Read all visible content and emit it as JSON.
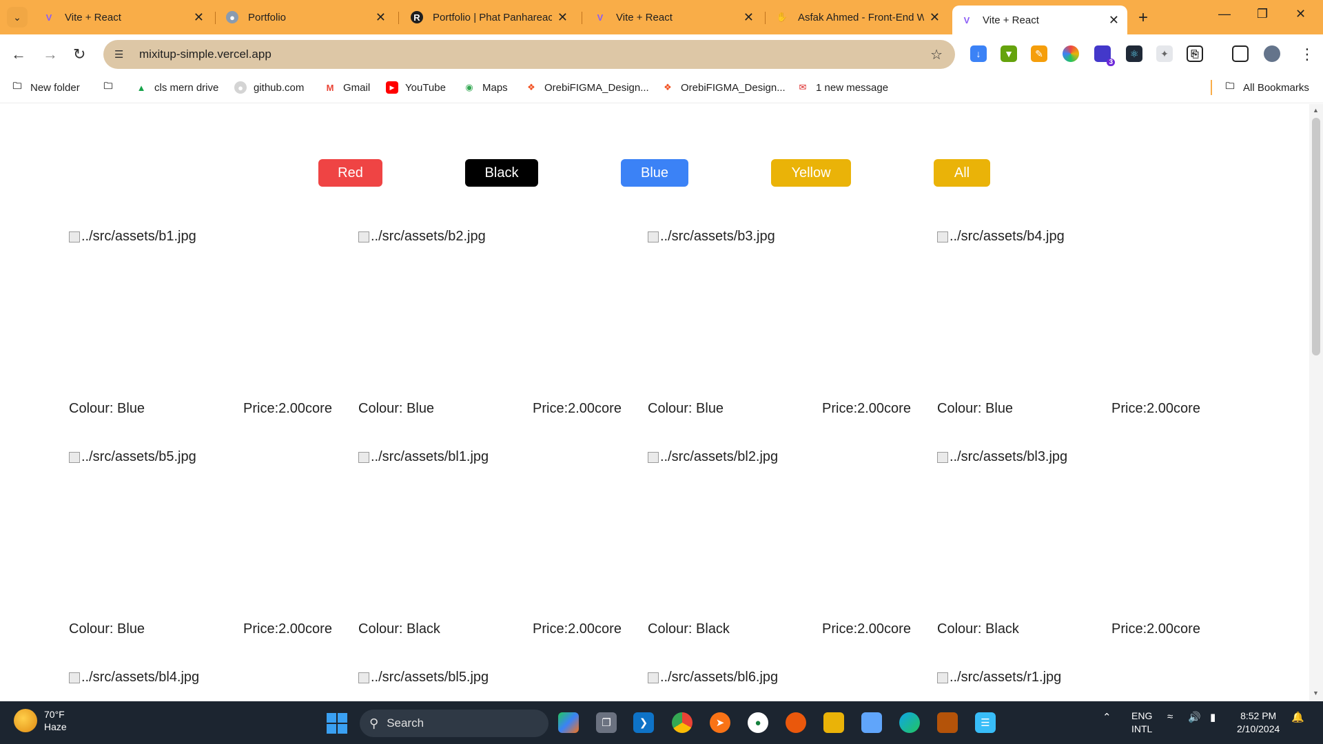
{
  "browser": {
    "tabs": [
      {
        "title": "Vite + React",
        "icon": "vite-logo-icon",
        "active": false
      },
      {
        "title": "Portfolio",
        "icon": "globe-icon",
        "active": false
      },
      {
        "title": "Portfolio | Phat Panhareach",
        "icon": "r-logo-icon",
        "active": false
      },
      {
        "title": "Vite + React",
        "icon": "vite-logo-icon",
        "active": false
      },
      {
        "title": "Asfak Ahmed - Front-End W",
        "icon": "hand-wave-icon",
        "active": false
      },
      {
        "title": "Vite + React",
        "icon": "vite-logo-icon",
        "active": true
      }
    ],
    "address": "mixitup-simple.vercel.app",
    "bookmarks": [
      {
        "label": "New folder",
        "icon": "folder-icon"
      },
      {
        "label": "",
        "icon": "folder-icon"
      },
      {
        "label": "cls mern drive",
        "icon": "google-drive-icon"
      },
      {
        "label": "github.com",
        "icon": "github-icon"
      },
      {
        "label": "Gmail",
        "icon": "gmail-icon"
      },
      {
        "label": "YouTube",
        "icon": "youtube-icon"
      },
      {
        "label": "Maps",
        "icon": "maps-pin-icon"
      },
      {
        "label": "OrebiFIGMA_Design...",
        "icon": "figma-icon"
      },
      {
        "label": "OrebiFIGMA_Design...",
        "icon": "figma-icon"
      },
      {
        "label": "1 new message",
        "icon": "message-icon"
      }
    ],
    "all_bookmarks": "All Bookmarks",
    "extension_badge": "3"
  },
  "page": {
    "filters": [
      {
        "label": "Red",
        "color": "#ef4444"
      },
      {
        "label": "Black",
        "color": "#000000"
      },
      {
        "label": "Blue",
        "color": "#3b82f6"
      },
      {
        "label": "Yellow",
        "color": "#eab308"
      },
      {
        "label": "All",
        "color": "#eab308"
      }
    ],
    "items": [
      {
        "img_alt": "../src/assets/b1.jpg",
        "colour": "Colour: Blue",
        "price": "Price:2.00core"
      },
      {
        "img_alt": "../src/assets/b2.jpg",
        "colour": "Colour: Blue",
        "price": "Price:2.00core"
      },
      {
        "img_alt": "../src/assets/b3.jpg",
        "colour": "Colour: Blue",
        "price": "Price:2.00core"
      },
      {
        "img_alt": "../src/assets/b4.jpg",
        "colour": "Colour: Blue",
        "price": "Price:2.00core"
      },
      {
        "img_alt": "../src/assets/b5.jpg",
        "colour": "Colour: Blue",
        "price": "Price:2.00core"
      },
      {
        "img_alt": "../src/assets/bl1.jpg",
        "colour": "Colour: Black",
        "price": "Price:2.00core"
      },
      {
        "img_alt": "../src/assets/bl2.jpg",
        "colour": "Colour: Black",
        "price": "Price:2.00core"
      },
      {
        "img_alt": "../src/assets/bl3.jpg",
        "colour": "Colour: Black",
        "price": "Price:2.00core"
      },
      {
        "img_alt": "../src/assets/bl4.jpg",
        "colour": "",
        "price": ""
      },
      {
        "img_alt": "../src/assets/bl5.jpg",
        "colour": "",
        "price": ""
      },
      {
        "img_alt": "../src/assets/bl6.jpg",
        "colour": "",
        "price": ""
      },
      {
        "img_alt": "../src/assets/r1.jpg",
        "colour": "",
        "price": ""
      }
    ]
  },
  "taskbar": {
    "weather_temp": "70°F",
    "weather_desc": "Haze",
    "search_placeholder": "Search",
    "lang_line1": "ENG",
    "lang_line2": "INTL",
    "time": "8:52 PM",
    "date": "2/10/2024"
  }
}
